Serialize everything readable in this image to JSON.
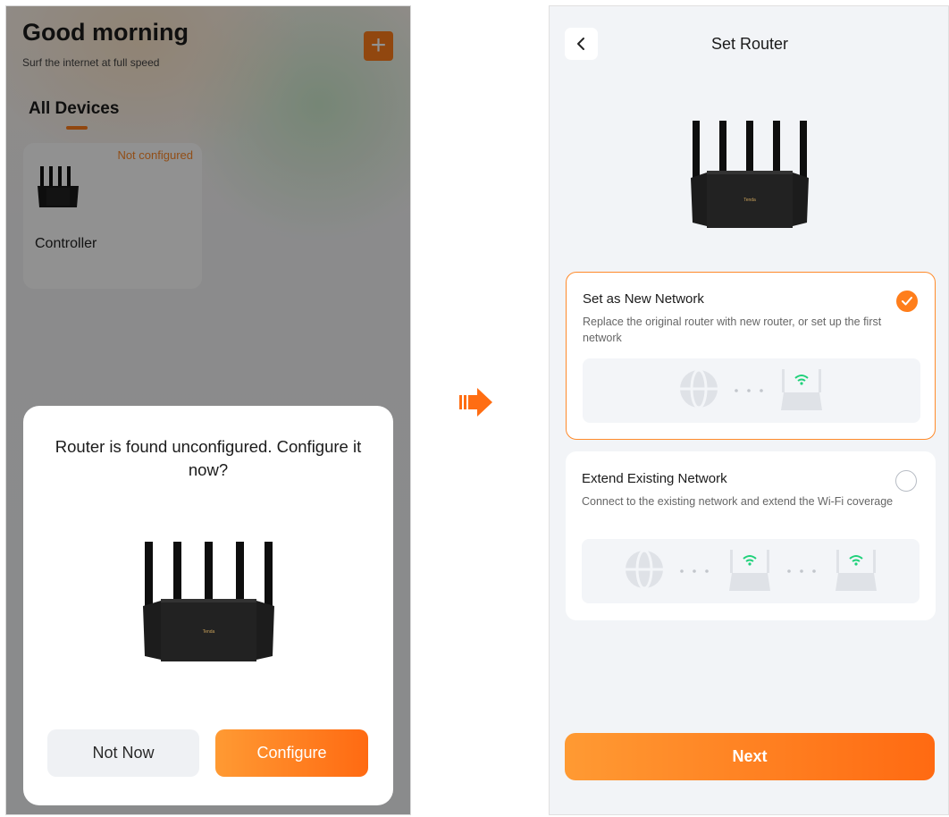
{
  "left_screen": {
    "greeting": "Good morning",
    "greeting_sub": "Surf the internet at full speed",
    "add_icon": "plus-icon",
    "tab_all": "All Devices",
    "device": {
      "status": "Not configured",
      "name": "Controller"
    },
    "dialog": {
      "title": "Router is found unconfigured. Configure it now?",
      "not_now_label": "Not Now",
      "configure_label": "Configure"
    }
  },
  "right_screen": {
    "back_icon": "chevron-left-icon",
    "title": "Set Router",
    "options": [
      {
        "title": "Set as New Network",
        "description": "Replace the original router with new router, or set up the first network",
        "selected": true
      },
      {
        "title": "Extend Existing Network",
        "description": "Connect to the existing network and extend the Wi-Fi coverage",
        "selected": false
      }
    ],
    "next_label": "Next"
  },
  "router_brand": "Tenda",
  "colors": {
    "accent": "#ff7e1b",
    "wifi": "#1fd17a"
  }
}
